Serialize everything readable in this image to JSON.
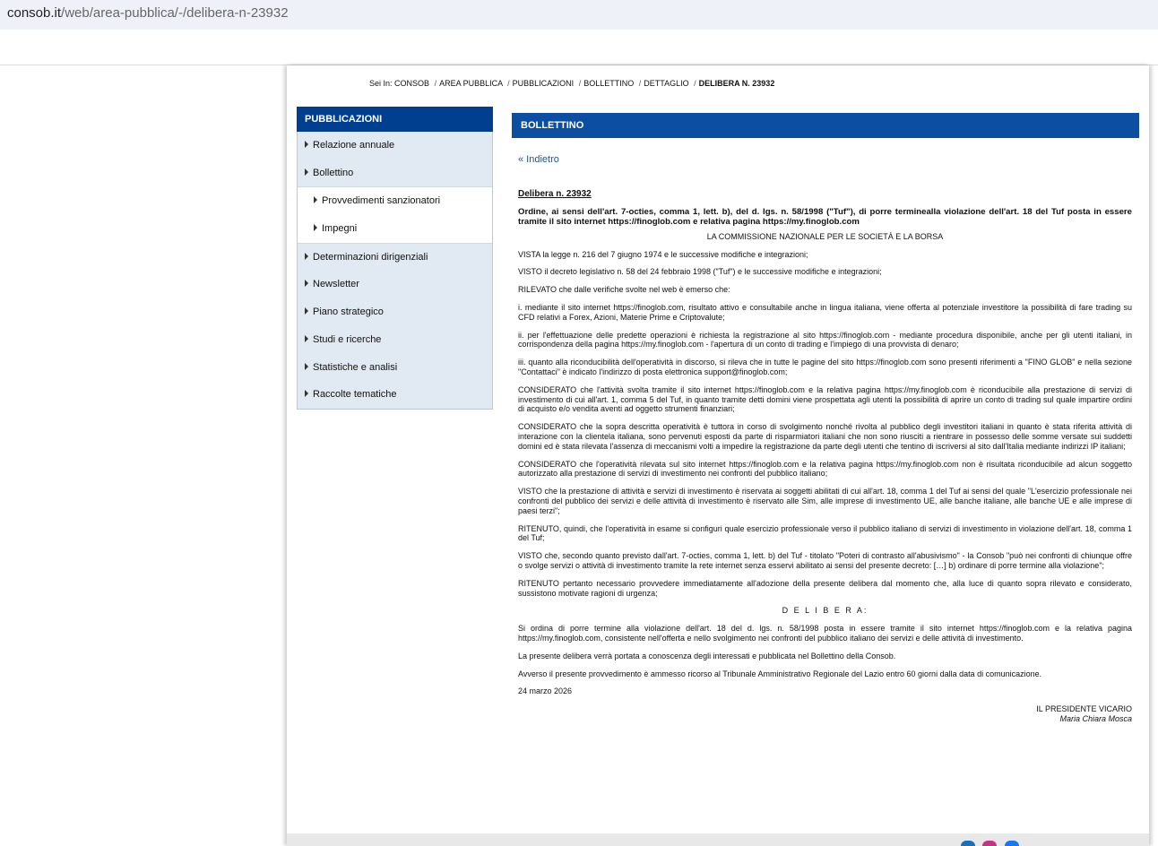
{
  "browser": {
    "url_host": "consob.it",
    "url_path": "/web/area-pubblica/-/delibera-n-23932"
  },
  "breadcrumb": {
    "prefix": "Sei In:",
    "items": [
      "CONSOB",
      "AREA PUBBLICA",
      "PUBBLICAZIONI",
      "BOLLETTINO",
      "DETTAGLIO"
    ],
    "current": "DELIBERA N. 23932"
  },
  "sidebar": {
    "title": "PUBBLICAZIONI",
    "items": [
      {
        "label": "Relazione annuale"
      },
      {
        "label": "Bollettino"
      },
      {
        "label": "Provvedimenti sanzionatori"
      },
      {
        "label": "Impegni"
      },
      {
        "label": "Determinazioni dirigenziali"
      },
      {
        "label": "Newsletter"
      },
      {
        "label": "Piano strategico"
      },
      {
        "label": "Studi e ricerche"
      },
      {
        "label": "Statistiche e analisi"
      },
      {
        "label": "Raccolte tematiche"
      }
    ]
  },
  "main": {
    "header": "BOLLETTINO",
    "back_link": "« Indietro"
  },
  "doc": {
    "title": "Delibera n. 23932",
    "subtitle": "Ordine, ai sensi dell'art. 7-octies, comma 1, lett. b), del d. lgs. n. 58/1998 (\"Tuf\"), di porre terminealla violazione dell'art. 18 del Tuf posta in essere tramite il sito internet https://finoglob.com e relativa pagina https://my.finoglob.com",
    "commission": "LA COMMISSIONE NAZIONALE PER LE SOCIETÀ E LA BORSA",
    "paragraphs": [
      "VISTA la legge n. 216 del 7 giugno 1974 e le successive modifiche e integrazioni;",
      "VISTO il decreto legislativo n. 58 del 24 febbraio 1998 (\"Tuf\") e le successive modifiche e integrazioni;",
      "RILEVATO che dalle verifiche svolte nel web è emerso che:",
      "i. mediante il sito internet https://finoglob.com, risultato attivo e consultabile anche in lingua italiana, viene offerta al potenziale investitore la possibilità di fare trading su CFD relativi a Forex, Azioni, Materie Prime e Criptovalute;",
      "ii. per l'effettuazione delle predette operazioni è richiesta la registrazione al sito https://finoglob.com - mediante procedura disponibile, anche per gli utenti italiani, in corrispondenza della pagina https://my.finoglob.com - l'apertura di un conto di trading e l'impiego di una provvista di denaro;",
      "iii. quanto alla riconducibilità dell'operatività in discorso, si rileva che in tutte le pagine del sito https://finoglob.com sono presenti riferimenti a \"FINO GLOB\" e nella sezione \"Contattaci\" è indicato l'indirizzo di posta elettronica support@finoglob.com;",
      "CONSIDERATO che l'attività svolta tramite il sito internet https://finoglob.com e la relativa pagina https://my.finoglob.com è riconducibile alla prestazione di servizi di investimento di cui all'art. 1, comma 5 del Tuf, in quanto tramite detti domini viene prospettata agli utenti la possibilità di aprire un conto di trading sul quale impartire ordini di acquisto e/o vendita aventi ad oggetto strumenti finanziari;",
      "CONSIDERATO che la sopra descritta operatività è tuttora in corso di svolgimento nonché rivolta al pubblico degli investitori italiani in quanto è stata riferita attività di interazione con la clientela italiana, sono pervenuti esposti da parte di risparmiatori italiani che non sono riusciti a rientrare in possesso delle somme versate sui suddetti domini ed è stata rilevata l'assenza di meccanismi volti a impedire la registrazione da parte degli utenti che tentino di iscriversi al sito dall'Italia mediante indirizzi IP italiani;",
      "CONSIDERATO che l'operatività rilevata sul sito internet https://finoglob.com e la relativa pagina https://my.finoglob.com non è risultata riconducibile ad alcun soggetto autorizzato alla prestazione di servizi di investimento nei confronti del pubblico italiano;",
      "VISTO che la prestazione di attività e servizi di investimento è riservata ai soggetti abilitati di cui all'art. 18, comma 1 del Tuf ai sensi del quale \"L'esercizio professionale nei confronti del pubblico dei servizi e delle attività di investimento è riservato alle Sim, alle imprese di investimento UE, alle banche italiane, alle banche UE e alle imprese di paesi terzi\";",
      "RITENUTO, quindi, che l'operatività in esame si configuri quale esercizio professionale verso il pubblico italiano di servizi di investimento in violazione dell'art. 18, comma 1 del Tuf;",
      "VISTO che, secondo quanto previsto dall'art. 7-octies, comma 1, lett. b) del Tuf - titolato \"Poteri di contrasto all'abusivismo\" - la Consob \"può nei confronti di chiunque offre o svolge servizi o attività di investimento tramite la rete internet senza esservi abilitato ai sensi del presente decreto: […] b) ordinare di porre termine alla violazione\";",
      "RITENUTO pertanto necessario provvedere immediatamente all'adozione della presente delibera dal momento che, alla luce di quanto sopra rilevato e considerato, sussistono motivate ragioni di urgenza;"
    ],
    "delibera_heading": "D E L I B E R A:",
    "closing": [
      "Si ordina di porre termine alla violazione dell'art. 18 del d. lgs. n. 58/1998 posta in essere tramite il sito internet https://finoglob.com e la relativa pagina https://my.finoglob.com, consistente nell'offerta e nello svolgimento nei confronti del pubblico italiano dei servizi e delle attività di investimento.",
      "La presente delibera verrà portata a conoscenza degli interessati e pubblicata nel Bollettino della Consob.",
      "Avverso il presente provvedimento è ammesso ricorso al Tribunale Amministrativo Regionale del Lazio entro 60 giorni dalla data di comunicazione.",
      "24 marzo 2026"
    ],
    "signature_title": "IL PRESIDENTE VICARIO",
    "signature_name": "Maria Chiara Mosca"
  },
  "colors": {
    "sidebar_header": "#003f8f",
    "content_header": "#0c4ea2",
    "link": "#1a56a8",
    "sidebar_bg": "#e1e9f2"
  }
}
